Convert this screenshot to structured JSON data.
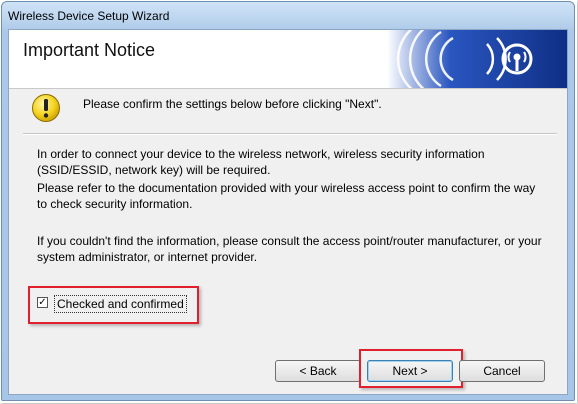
{
  "window": {
    "title": "Wireless Device Setup Wizard"
  },
  "header": {
    "title": "Important Notice",
    "logo_icon": "wireless-signal-icon"
  },
  "notice": {
    "icon": "warning-icon",
    "text": "Please confirm the settings below before clicking \"Next\"."
  },
  "body": {
    "line1": "In order to connect your device to the wireless network, wireless security information (SSID/ESSID, network key) will be required.",
    "line2": "Please refer to the documentation provided with your wireless access point to confirm the way to check security information.",
    "line3": "If you couldn't find the information, please consult the access point/router manufacturer, or your system administrator, or internet provider."
  },
  "checkbox": {
    "label": "Checked and confirmed",
    "checked": true,
    "mark": "✓"
  },
  "buttons": {
    "back": "< Back",
    "next": "Next >",
    "cancel": "Cancel"
  },
  "colors": {
    "highlight": "#e0202c",
    "logo_blue": "#1a3d9a"
  }
}
